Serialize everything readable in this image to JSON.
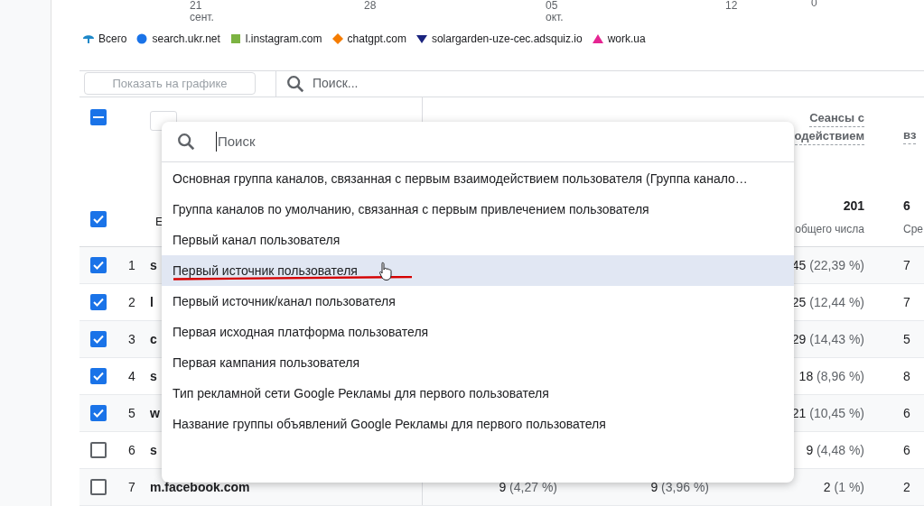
{
  "chart_axis": {
    "ticks": [
      {
        "day": "21",
        "month": "сент."
      },
      {
        "day": "28"
      },
      {
        "day": "05",
        "month": "окт."
      },
      {
        "day": "12"
      }
    ],
    "end_label": "0"
  },
  "legend": [
    {
      "kind": "total",
      "label": "Всего",
      "color": "#1e88c8"
    },
    {
      "kind": "circle",
      "label": "search.ukr.net",
      "color": "#1a73e8"
    },
    {
      "kind": "square",
      "label": "l.instagram.com",
      "color": "#7cb342"
    },
    {
      "kind": "diamond",
      "label": "chatgpt.com",
      "color": "#f57c00"
    },
    {
      "kind": "triangle-down",
      "label": "solargarden-uze-cec.adsquiz.io",
      "color": "#1a237e"
    },
    {
      "kind": "triangle-up",
      "label": "work.ua",
      "color": "#e52592"
    }
  ],
  "toolbar": {
    "show_button": {
      "label": "Показать на графике",
      "disabled": true
    },
    "search": {
      "placeholder": "Поиск..."
    }
  },
  "table": {
    "select_all": {
      "indeterminate": true
    },
    "header_checkbox": {
      "checked": true
    },
    "dimension_header": "Е",
    "engaged_header": {
      "line_1": "Сеансы с",
      "line_2": "одействием",
      "total": "201",
      "total_caption": "общего числа"
    },
    "column_5_header": {
      "title": "вз",
      "total": "6",
      "total_caption": "Сре"
    },
    "rows": [
      {
        "index": "1",
        "selected": true,
        "dimension": "s",
        "engaged": "45",
        "engaged_share": "(22,39 %)",
        "column_5": "7"
      },
      {
        "index": "2",
        "selected": true,
        "dimension": "l",
        "engaged": "25",
        "engaged_share": "(12,44 %)",
        "column_5": "7"
      },
      {
        "index": "3",
        "selected": true,
        "dimension": "c",
        "engaged": "29",
        "engaged_share": "(14,43 %)",
        "column_5": "5"
      },
      {
        "index": "4",
        "selected": true,
        "dimension": "s",
        "engaged": "18",
        "engaged_share": "(8,96 %)",
        "column_5": "8"
      },
      {
        "index": "5",
        "selected": true,
        "dimension": "w",
        "engaged": "21",
        "engaged_share": "(10,45 %)",
        "column_5": "6"
      },
      {
        "index": "6",
        "selected": false,
        "dimension": "s",
        "engaged": "9",
        "engaged_share": "(4,48 %)",
        "column_5": "6"
      },
      {
        "index": "7",
        "selected": false,
        "dimension": "m.facebook.com",
        "column_2": "9",
        "column_2_share": "(4,27 %)",
        "column_3": "9",
        "column_3_share": "(3,96 %)",
        "engaged": "2",
        "engaged_share": "(1 %)",
        "column_5": "2"
      }
    ]
  },
  "dropdown": {
    "search": {
      "placeholder": "Поиск"
    },
    "options": [
      {
        "label": "Основная группа каналов, связанная с первым взаимодействием пользователя (Группа канало…",
        "selected": false
      },
      {
        "label": "Группа каналов по умолчанию, связанная с первым привлечением пользователя",
        "selected": false
      },
      {
        "label": "Первый канал пользователя",
        "selected": false
      },
      {
        "label": "Первый источник пользователя",
        "selected": true
      },
      {
        "label": "Первый источник/канал пользователя",
        "selected": false
      },
      {
        "label": "Первая исходная платформа пользователя",
        "selected": false
      },
      {
        "label": "Первая кампания пользователя",
        "selected": false
      },
      {
        "label": "Тип рекламной сети Google Рекламы для первого пользователя",
        "selected": false
      },
      {
        "label": "Название группы объявлений Google Рекламы для первого пользователя",
        "selected": false
      }
    ]
  }
}
